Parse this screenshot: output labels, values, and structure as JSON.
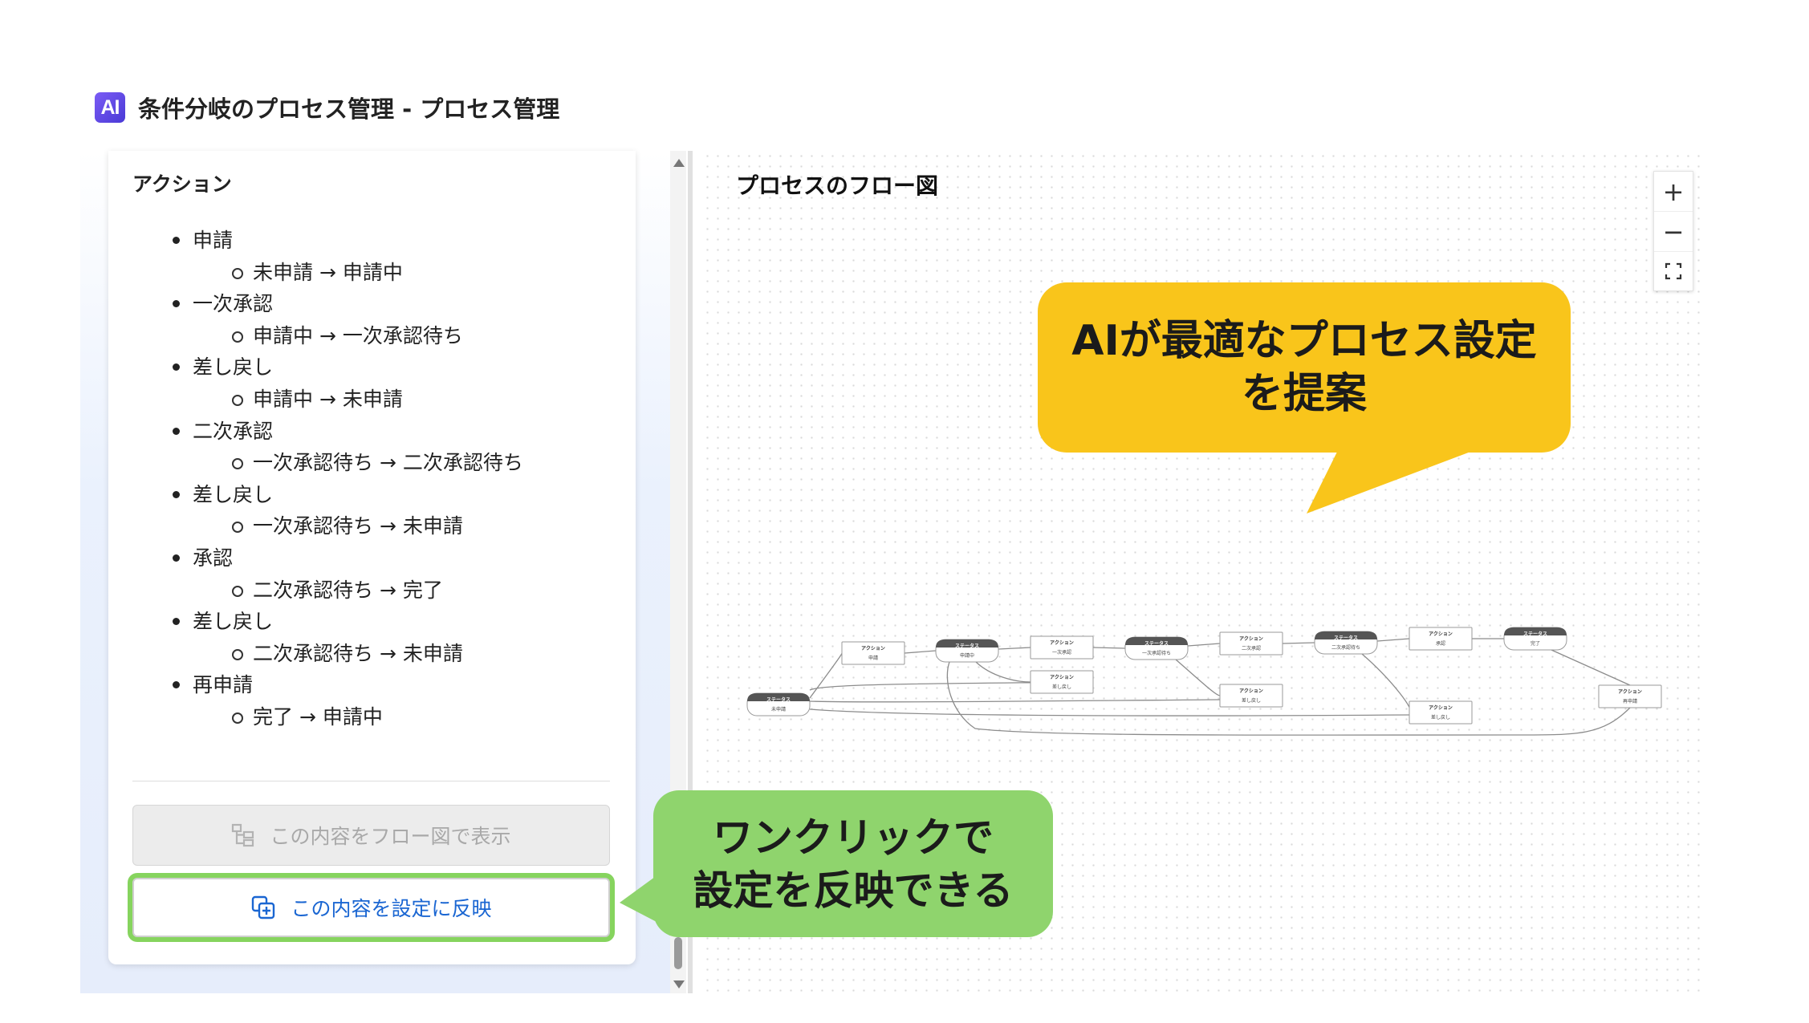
{
  "header": {
    "logo_text": "AI",
    "title": "条件分岐のプロセス管理 - プロセス管理"
  },
  "left_panel": {
    "heading": "アクション",
    "actions": [
      {
        "name": "申請",
        "transition": "未申請 → 申請中"
      },
      {
        "name": "一次承認",
        "transition": "申請中 → 一次承認待ち"
      },
      {
        "name": "差し戻し",
        "transition": "申請中 → 未申請"
      },
      {
        "name": "二次承認",
        "transition": "一次承認待ち → 二次承認待ち"
      },
      {
        "name": "差し戻し",
        "transition": "一次承認待ち → 未申請"
      },
      {
        "name": "承認",
        "transition": "二次承認待ち → 完了"
      },
      {
        "name": "差し戻し",
        "transition": "二次承認待ち → 未申請"
      },
      {
        "name": "再申請",
        "transition": "完了 → 申請中"
      }
    ],
    "show_flow_button": "この内容をフロー図で表示",
    "apply_button": "この内容を設定に反映"
  },
  "right_panel": {
    "title": "プロセスのフロー図",
    "zoom_in": "+",
    "zoom_out": "−",
    "fit_view_icon": "fit-view-icon",
    "flow": {
      "status_header": "ステータス",
      "action_header": "アクション",
      "statuses": [
        "未申請",
        "申請中",
        "一次承認待ち",
        "二次承認待ち",
        "完了"
      ],
      "actions": [
        "申請",
        "一次承認",
        "差し戻し",
        "二次承認",
        "差し戻し",
        "承認",
        "差し戻し",
        "再申請"
      ]
    }
  },
  "callouts": {
    "yellow_line1": "AIが最適なプロセス設定",
    "yellow_line2": "を提案",
    "green_line1": "ワンクリックで",
    "green_line2": "設定を反映できる"
  },
  "colors": {
    "yellow": "#f9c51b",
    "green": "#8fd46d",
    "accent_blue": "#1a66d2",
    "logo_purple": "#6a4cf0"
  }
}
